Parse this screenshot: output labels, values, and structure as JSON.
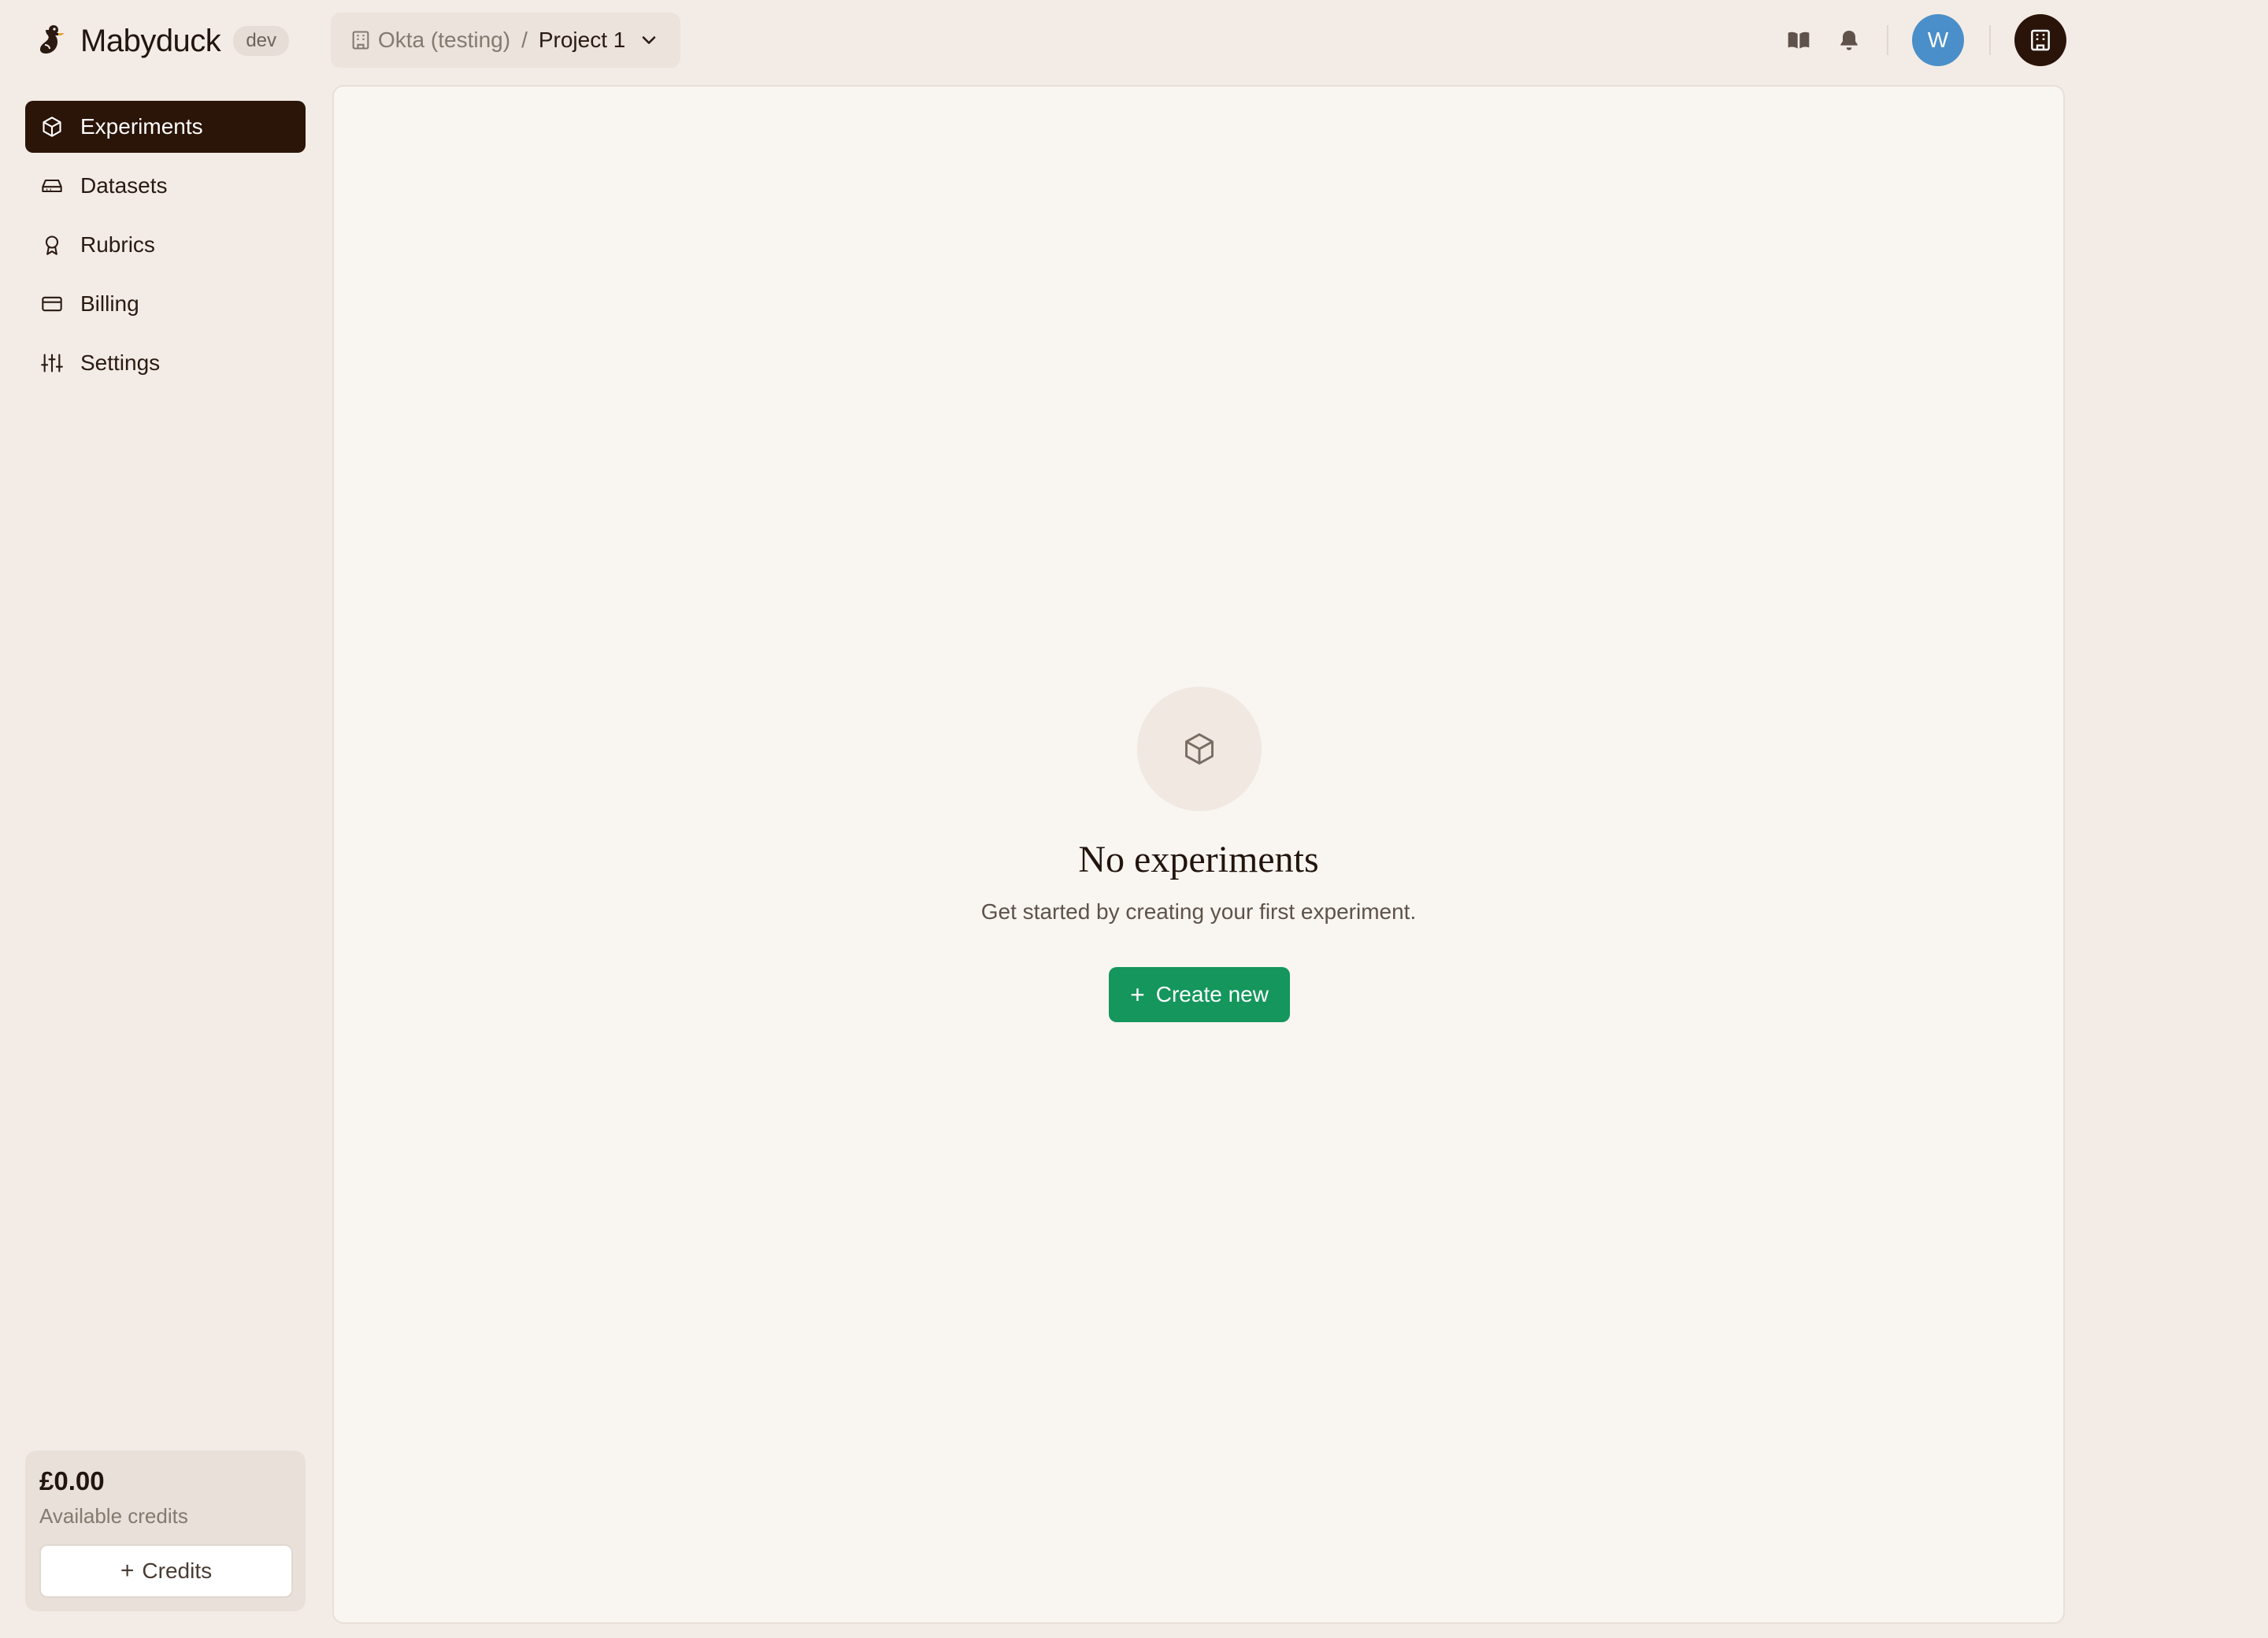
{
  "brand": {
    "name": "Mabyduck",
    "env_badge": "dev",
    "logo_icon": "duck-logo-icon"
  },
  "breadcrumb": {
    "org_icon": "building-icon",
    "org": "Okta (testing)",
    "separator": "/",
    "project": "Project 1",
    "dropdown_icon": "chevron-down-icon"
  },
  "header_actions": {
    "docs_icon": "book-icon",
    "notifications_icon": "bell-icon",
    "avatar_initial": "W",
    "org_switcher_icon": "building-icon"
  },
  "sidebar": {
    "items": [
      {
        "label": "Experiments",
        "icon": "cube-icon",
        "active": true
      },
      {
        "label": "Datasets",
        "icon": "drive-icon",
        "active": false
      },
      {
        "label": "Rubrics",
        "icon": "award-icon",
        "active": false
      },
      {
        "label": "Billing",
        "icon": "credit-card-icon",
        "active": false
      },
      {
        "label": "Settings",
        "icon": "sliders-icon",
        "active": false
      }
    ]
  },
  "credits": {
    "amount": "£0.00",
    "label": "Available credits",
    "button_label": "Credits",
    "button_icon": "plus-icon"
  },
  "empty_state": {
    "icon": "cube-icon",
    "title": "No experiments",
    "subtitle": "Get started by creating your first experiment.",
    "button_label": "Create new",
    "button_icon": "plus-icon"
  },
  "colors": {
    "background": "#f3ece6",
    "active_nav": "#2b1408",
    "primary_button": "#14965c",
    "avatar": "#4a8fc9"
  }
}
